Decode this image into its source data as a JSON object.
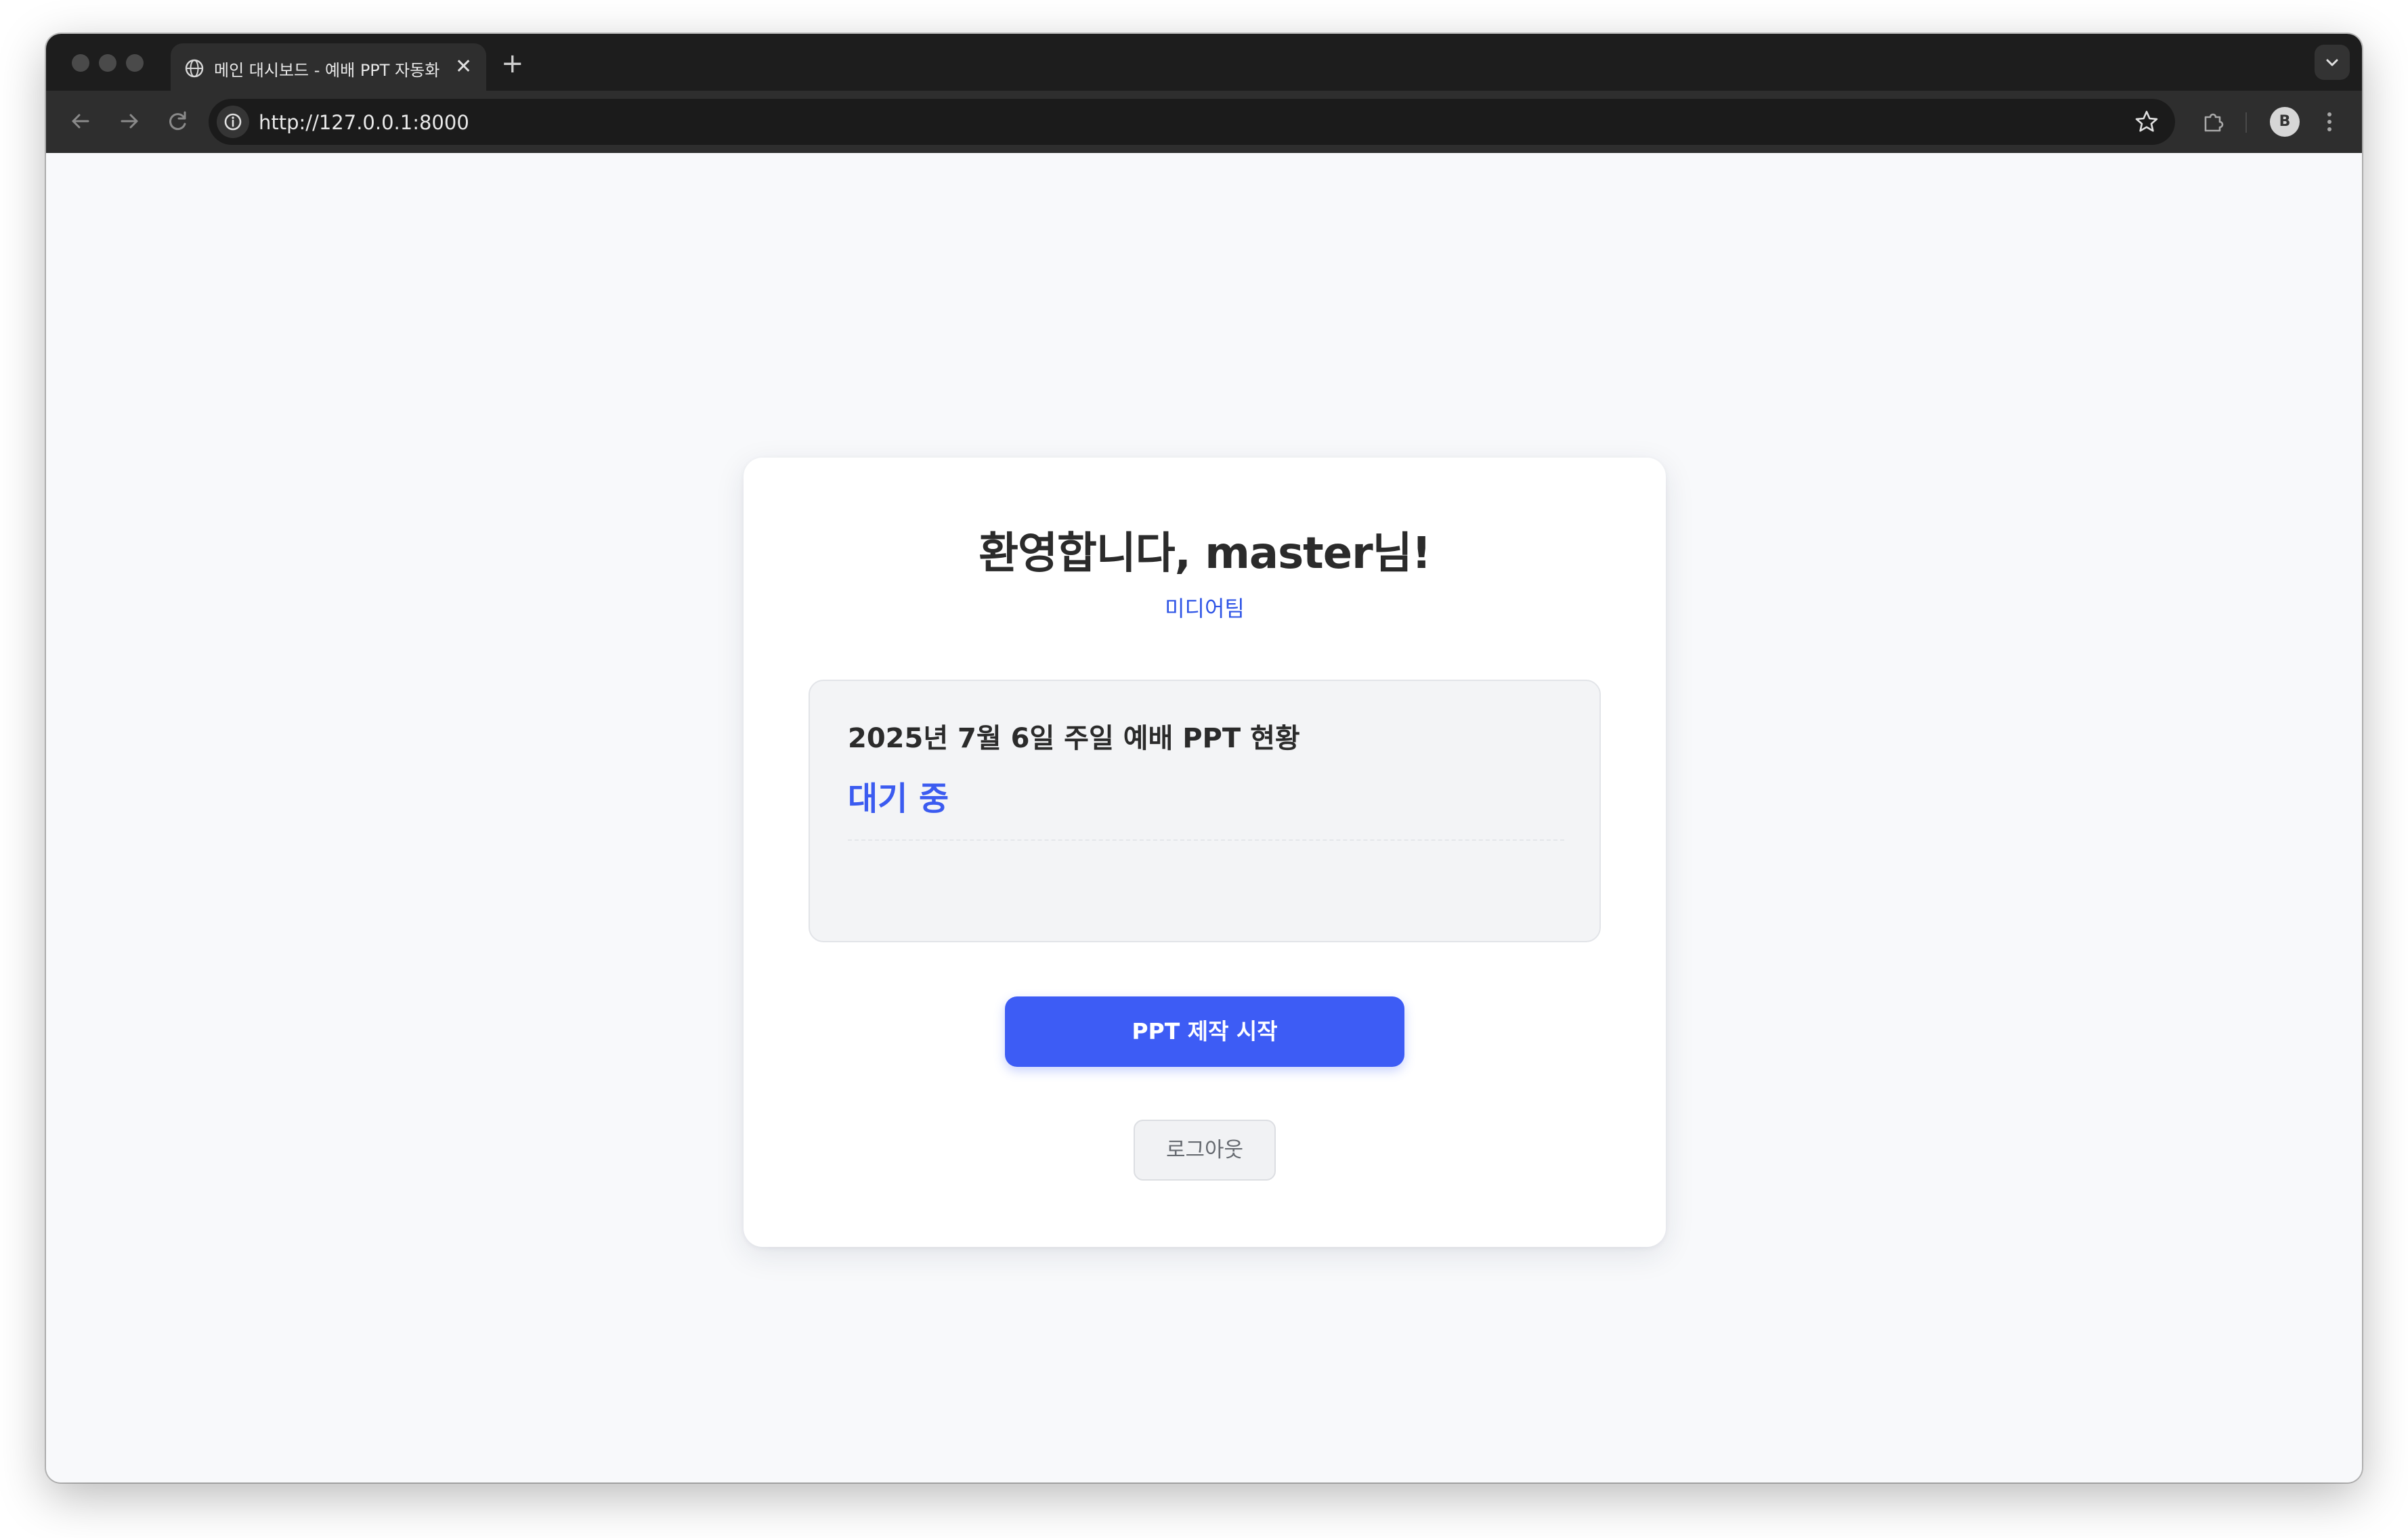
{
  "browser": {
    "tab": {
      "title": "메인 대시보드 - 예배 PPT 자동화",
      "favicon": "globe-icon",
      "close_symbol": "✕"
    },
    "new_tab_symbol": "+",
    "url": "http://127.0.0.1:8000",
    "profile_initial": "B"
  },
  "page": {
    "welcome": "환영합니다, master님!",
    "team": "미디어팀",
    "status": {
      "title": "2025년 7월 6일 주일 예배 PPT 현황",
      "value": "대기 중"
    },
    "start_button": "PPT 제작 시작",
    "logout_button": "로그아웃"
  },
  "colors": {
    "accent": "#3d5cf5",
    "team_text": "#2f55e6",
    "status_value": "#3b5bf0",
    "page_background": "#f8f9fb"
  }
}
